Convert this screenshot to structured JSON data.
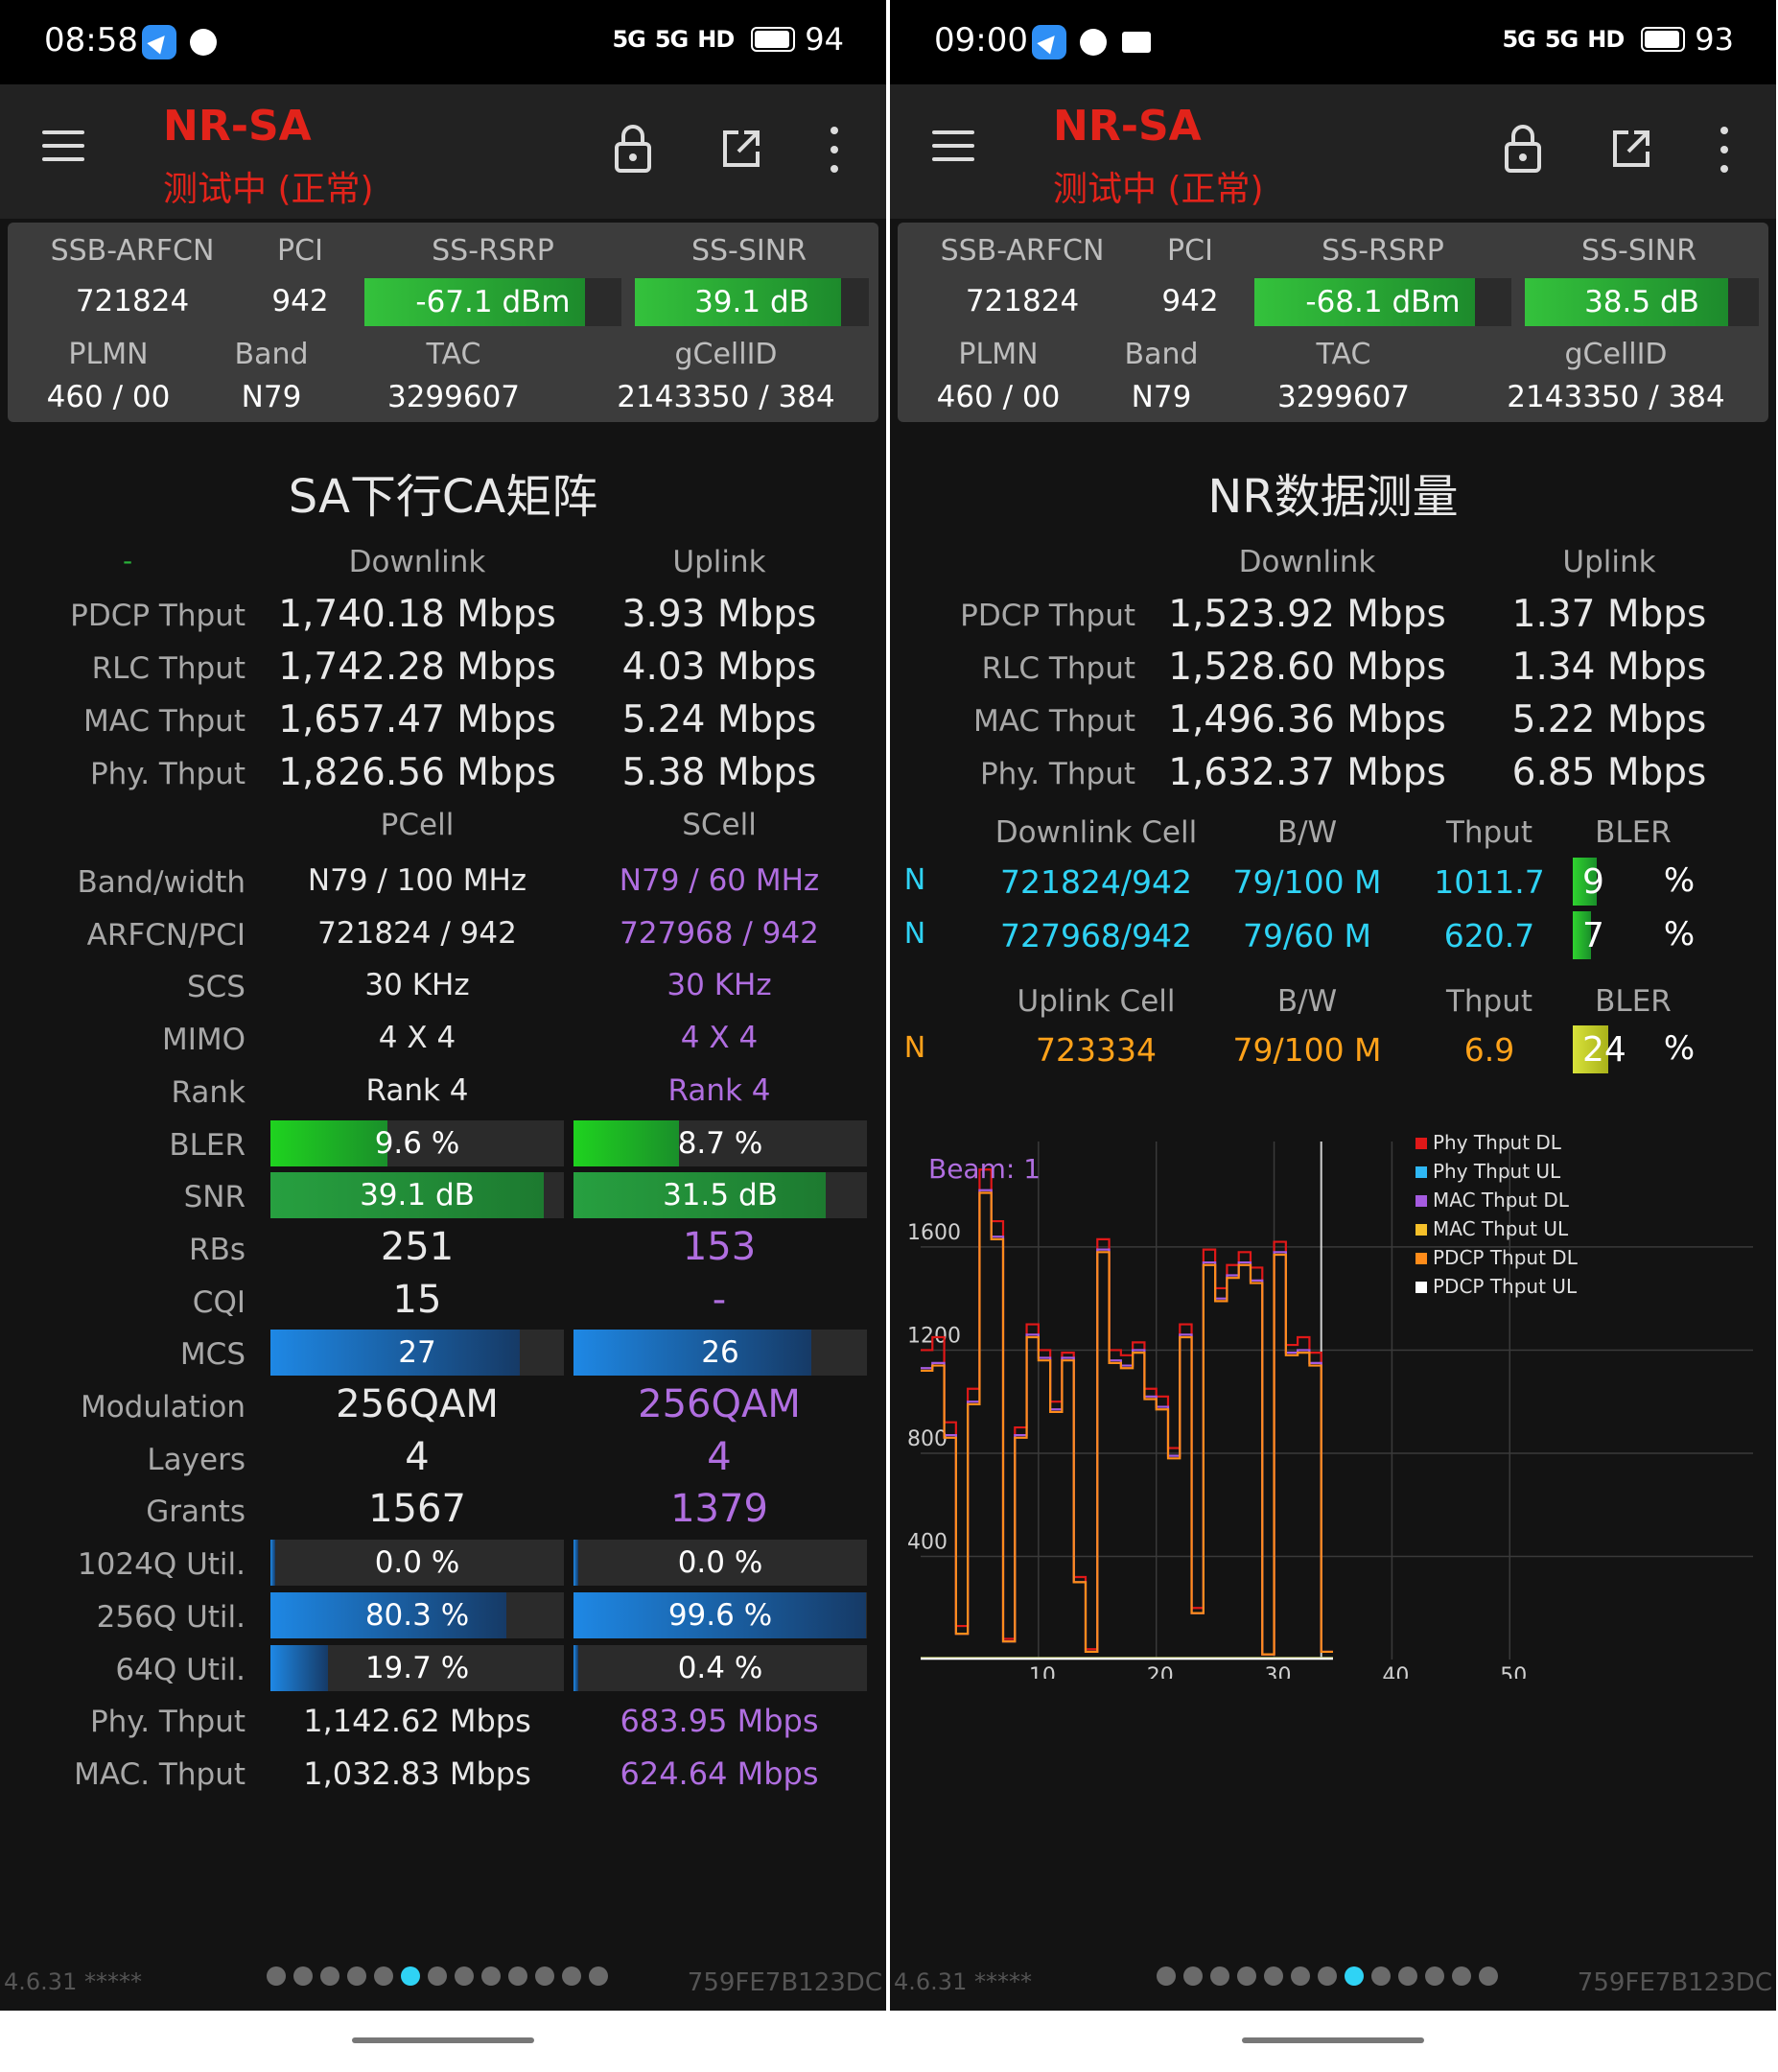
{
  "left": {
    "status": {
      "time": "08:58",
      "signal1": "5G",
      "signal2": "5G",
      "hd": "HD",
      "battery": "94"
    },
    "toolbar": {
      "title": "NR-SA",
      "subtitle": "测试中 (正常)"
    },
    "info": {
      "headers1": [
        "SSB-ARFCN",
        "PCI",
        "SS-RSRP",
        "SS-SINR"
      ],
      "arfcn": "721824",
      "pci": "942",
      "rsrp": "-67.1 dBm",
      "sinr": "39.1 dB",
      "rsrp_level": 0.86,
      "sinr_level": 0.88,
      "headers2": [
        "PLMN",
        "Band",
        "TAC",
        "gCellID"
      ],
      "plmn": "460 / 00",
      "band": "N79",
      "tac": "3299607",
      "gcellid": "2143350 / 384"
    },
    "section_title": "SA下行CA矩阵",
    "dash": "-",
    "thput_heads": [
      "Downlink",
      "Uplink"
    ],
    "thput_rows": [
      {
        "label": "PDCP Thput",
        "dl": "1,740.18 Mbps",
        "ul": "3.93 Mbps"
      },
      {
        "label": "RLC Thput",
        "dl": "1,742.28 Mbps",
        "ul": "4.03 Mbps"
      },
      {
        "label": "MAC Thput",
        "dl": "1,657.47 Mbps",
        "ul": "5.24 Mbps"
      },
      {
        "label": "Phy. Thput",
        "dl": "1,826.56 Mbps",
        "ul": "5.38 Mbps"
      }
    ],
    "cell_heads": [
      "PCell",
      "SCell"
    ],
    "ca_rows": [
      {
        "label": "Band/width",
        "p": "N79 / 100 MHz",
        "s": "N79 / 60 MHz"
      },
      {
        "label": "ARFCN/PCI",
        "p": "721824 / 942",
        "s": "727968 / 942"
      },
      {
        "label": "SCS",
        "p": "30 KHz",
        "s": "30 KHz"
      },
      {
        "label": "MIMO",
        "p": "4 X 4",
        "s": "4 X 4"
      },
      {
        "label": "Rank",
        "p": "Rank 4",
        "s": "Rank 4"
      }
    ],
    "bler": {
      "label": "BLER",
      "p": "9.6 %",
      "s": "8.7 %",
      "p_level": 0.4,
      "s_level": 0.36
    },
    "snr": {
      "label": "SNR",
      "p": "39.1 dB",
      "s": "31.5 dB",
      "p_level": 0.93,
      "s_level": 0.86
    },
    "rbs": {
      "label": "RBs",
      "p": "251",
      "s": "153"
    },
    "cqi": {
      "label": "CQI",
      "p": "15",
      "s": "-"
    },
    "mcs": {
      "label": "MCS",
      "p": "27",
      "s": "26",
      "p_level": 0.85,
      "s_level": 0.81
    },
    "modulation": {
      "label": "Modulation",
      "p": "256QAM",
      "s": "256QAM"
    },
    "layers": {
      "label": "Layers",
      "p": "4",
      "s": "4"
    },
    "grants": {
      "label": "Grants",
      "p": "1567",
      "s": "1379"
    },
    "q1024": {
      "label": "1024Q Util.",
      "p": "0.0 %",
      "s": "0.0 %",
      "p_level": 0.0,
      "s_level": 0.0
    },
    "q256": {
      "label": "256Q Util.",
      "p": "80.3 %",
      "s": "99.6 %",
      "p_level": 0.803,
      "s_level": 0.996
    },
    "q64": {
      "label": "64Q Util.",
      "p": "19.7 %",
      "s": "0.4 %",
      "p_level": 0.197,
      "s_level": 0.004
    },
    "phy": {
      "label": "Phy. Thput",
      "p": "1,142.62 Mbps",
      "s": "683.95 Mbps"
    },
    "mac": {
      "label": "MAC. Thput",
      "p": "1,032.83 Mbps",
      "s": "624.64 Mbps"
    },
    "footer": {
      "version": "4.6.31 *****",
      "device": "759FE7B123DC",
      "page_active": 5,
      "page_count": 13
    }
  },
  "right": {
    "status": {
      "time": "09:00",
      "signal1": "5G",
      "signal2": "5G",
      "hd": "HD",
      "battery": "93"
    },
    "toolbar": {
      "title": "NR-SA",
      "subtitle": "测试中 (正常)"
    },
    "info": {
      "headers1": [
        "SSB-ARFCN",
        "PCI",
        "SS-RSRP",
        "SS-SINR"
      ],
      "arfcn": "721824",
      "pci": "942",
      "rsrp": "-68.1 dBm",
      "sinr": "38.5 dB",
      "rsrp_level": 0.86,
      "sinr_level": 0.87,
      "headers2": [
        "PLMN",
        "Band",
        "TAC",
        "gCellID"
      ],
      "plmn": "460 / 00",
      "band": "N79",
      "tac": "3299607",
      "gcellid": "2143350 / 384"
    },
    "section_title": "NR数据测量",
    "thput_heads": [
      "Downlink",
      "Uplink"
    ],
    "thput_rows": [
      {
        "label": "PDCP Thput",
        "dl": "1,523.92 Mbps",
        "ul": "1.37 Mbps"
      },
      {
        "label": "RLC Thput",
        "dl": "1,528.60 Mbps",
        "ul": "1.34 Mbps"
      },
      {
        "label": "MAC Thput",
        "dl": "1,496.36 Mbps",
        "ul": "5.22 Mbps"
      },
      {
        "label": "Phy. Thput",
        "dl": "1,632.37 Mbps",
        "ul": "6.85 Mbps"
      }
    ],
    "dl_cell_heads": [
      "Downlink Cell",
      "B/W",
      "Thput",
      "BLER"
    ],
    "dl_cells": [
      {
        "tag": "N",
        "cell": "721824/942",
        "bw": "79/100 M",
        "thput": "1011.7",
        "bler": "9",
        "unit": "%",
        "level": 0.27
      },
      {
        "tag": "N",
        "cell": "727968/942",
        "bw": "79/60 M",
        "thput": "620.7",
        "bler": "7",
        "unit": "%",
        "level": 0.21
      }
    ],
    "ul_cell_heads": [
      "Uplink Cell",
      "B/W",
      "Thput",
      "BLER"
    ],
    "ul_cells": [
      {
        "tag": "N",
        "cell": "723334",
        "bw": "79/100 M",
        "thput": "6.9",
        "bler": "24",
        "unit": "%",
        "level": 0.4
      }
    ],
    "chart": {
      "beam_label": "Beam: 1",
      "colors": {
        "phy_dl": "#e01818",
        "phy_ul": "#2fb8f5",
        "mac_dl": "#a55be0",
        "mac_ul": "#f5c02a",
        "pdcp_dl": "#ff8c1a",
        "pdcp_ul": "#ffffff"
      }
    },
    "footer": {
      "version": "4.6.31 *****",
      "device": "759FE7B123DC",
      "page_active": 7,
      "page_count": 13
    }
  },
  "chart_data": {
    "type": "line",
    "title": "",
    "xlabel": "",
    "ylabel": "",
    "xlim": [
      0,
      60
    ],
    "ylim": [
      0,
      2000
    ],
    "x_ticks": [
      "10",
      "20",
      "30",
      "40",
      "50"
    ],
    "y_ticks": [
      "400",
      "800",
      "1200",
      "1600"
    ],
    "legend_position": "top-right",
    "x": [
      0,
      1,
      2,
      3,
      4,
      5,
      6,
      7,
      8,
      9,
      10,
      11,
      12,
      13,
      14,
      15,
      16,
      17,
      18,
      19,
      20,
      21,
      22,
      23,
      24,
      25,
      26,
      27,
      28,
      29,
      30,
      31,
      32,
      33,
      34
    ],
    "series": [
      {
        "name": "Phy Thput DL",
        "values": [
          1200,
          1250,
          920,
          130,
          1050,
          1900,
          1700,
          80,
          900,
          1300,
          1200,
          1000,
          1190,
          320,
          40,
          1630,
          1200,
          1180,
          1230,
          1050,
          1020,
          820,
          1300,
          200,
          1590,
          1440,
          1530,
          1580,
          1520,
          20,
          1620,
          1220,
          1250,
          1190,
          30
        ]
      },
      {
        "name": "Phy Thput UL",
        "values": [
          6,
          6,
          6,
          6,
          6,
          6,
          6,
          6,
          6,
          6,
          6,
          6,
          6,
          6,
          6,
          6,
          6,
          6,
          6,
          6,
          6,
          6,
          6,
          6,
          6,
          6,
          6,
          6,
          6,
          6,
          6,
          6,
          6,
          6,
          6
        ]
      },
      {
        "name": "MAC Thput DL",
        "values": [
          1130,
          1150,
          870,
          100,
          1000,
          1820,
          1640,
          70,
          870,
          1260,
          1170,
          970,
          1170,
          300,
          30,
          1590,
          1160,
          1140,
          1200,
          1020,
          980,
          790,
          1260,
          180,
          1540,
          1400,
          1490,
          1540,
          1470,
          20,
          1580,
          1190,
          1200,
          1150,
          30
        ]
      },
      {
        "name": "MAC Thput UL",
        "values": [
          5,
          5,
          5,
          5,
          5,
          5,
          5,
          5,
          5,
          5,
          5,
          5,
          5,
          5,
          5,
          5,
          5,
          5,
          5,
          5,
          5,
          5,
          5,
          5,
          5,
          5,
          5,
          5,
          5,
          5,
          5,
          5,
          5,
          5,
          5
        ]
      },
      {
        "name": "PDCP Thput DL",
        "values": [
          1120,
          1140,
          860,
          100,
          990,
          1810,
          1630,
          70,
          860,
          1250,
          1160,
          960,
          1160,
          300,
          30,
          1580,
          1150,
          1130,
          1190,
          1010,
          970,
          780,
          1250,
          180,
          1530,
          1390,
          1480,
          1530,
          1460,
          20,
          1570,
          1180,
          1190,
          1140,
          30
        ]
      },
      {
        "name": "PDCP Thput UL",
        "values": [
          3,
          3,
          3,
          3,
          3,
          3,
          3,
          3,
          3,
          3,
          3,
          3,
          3,
          3,
          3,
          3,
          3,
          3,
          3,
          3,
          3,
          3,
          3,
          3,
          3,
          3,
          3,
          3,
          3,
          3,
          3,
          3,
          3,
          3,
          3
        ]
      }
    ]
  }
}
